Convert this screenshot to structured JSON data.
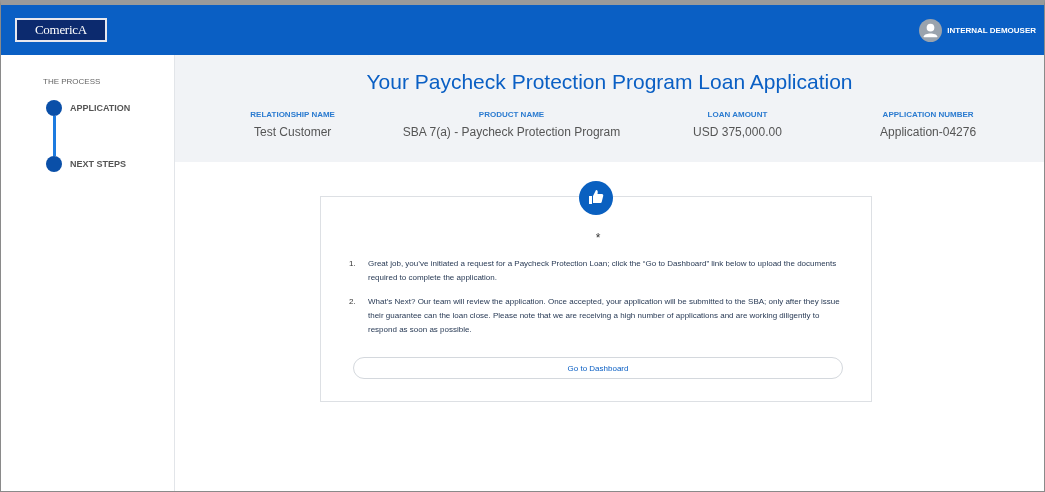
{
  "header": {
    "logo": "ComericA",
    "user": "INTERNAL DEMOUSER"
  },
  "sidebar": {
    "title": "THE PROCESS",
    "steps": [
      {
        "label": "APPLICATION"
      },
      {
        "label": "NEXT STEPS"
      }
    ]
  },
  "summary": {
    "title": "Your Paycheck Protection Program Loan Application",
    "fields": [
      {
        "label": "RELATIONSHIP NAME",
        "value": "Test Customer"
      },
      {
        "label": "PRODUCT NAME",
        "value": "SBA 7(a) - Paycheck Protection Program"
      },
      {
        "label": "LOAN AMOUNT",
        "value": "USD 375,000.00"
      },
      {
        "label": "APPLICATION NUMBER",
        "value": "Application-04276"
      }
    ]
  },
  "card": {
    "mark": "*",
    "items": [
      {
        "number": "1.",
        "text": "Great job, you’ve initiated a request for a Paycheck Protection Loan; click the “Go to Dashboard” link below to upload the documents required to complete the application."
      },
      {
        "number": "2.",
        "text": "What’s Next? Our team will review the application. Once accepted, your application will be submitted to the SBA; only after they issue their guarantee can the loan close. Please note that we are receiving a high number of applications and are working diligently to respond as soon as possible."
      }
    ],
    "button": "Go to Dashboard"
  }
}
